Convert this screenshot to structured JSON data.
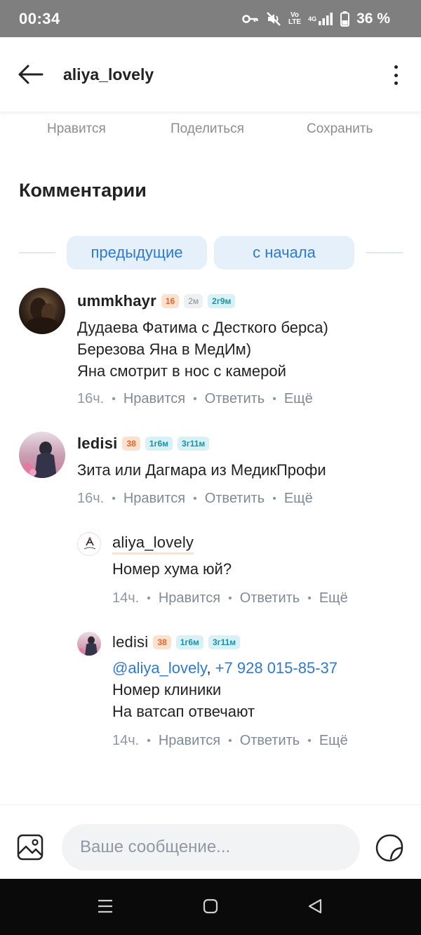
{
  "status_bar": {
    "time": "00:34",
    "battery": "36 %",
    "network_top": "Vo",
    "network_bottom": "LTE",
    "signal_type": "4G",
    "icons": [
      "key-icon",
      "mute-icon",
      "volte-icon",
      "signal-icon",
      "battery-icon"
    ]
  },
  "header": {
    "title": "aliya_lovely",
    "back_icon": "arrow-left-icon",
    "more_icon": "more-vertical-icon"
  },
  "actions": {
    "like": "Нравится",
    "share": "Поделиться",
    "save": "Сохранить"
  },
  "comments_section": {
    "title": "Комментарии",
    "load_previous": "предыдущие",
    "load_from_start": "с начала"
  },
  "comments": [
    {
      "author": "ummkhayr",
      "badges": [
        "16",
        "2м",
        "2г9м"
      ],
      "lines": [
        "Дудаева Фатима с Десткого берса)",
        "Березова Яна в МедИм)",
        "Яна смотрит в нос с камерой"
      ],
      "time": "16ч.",
      "like": "Нравится",
      "reply": "Ответить",
      "more": "Ещё"
    },
    {
      "author": "ledisi",
      "badges": [
        "38",
        "1г6м",
        "3г11м"
      ],
      "lines": [
        "Зита или Дагмара из МедикПрофи"
      ],
      "time": "16ч.",
      "like": "Нравится",
      "reply": "Ответить",
      "more": "Ещё"
    }
  ],
  "replies": [
    {
      "author": "aliya_lovely",
      "lines": [
        "Номер хума юй?"
      ],
      "time": "14ч.",
      "like": "Нравится",
      "reply": "Ответить",
      "more": "Ещё"
    },
    {
      "author": "ledisi",
      "badges": [
        "38",
        "1г6м",
        "3г11м"
      ],
      "mention": "@aliya_lovely",
      "separator": ",",
      "phone": "+7 928 015-85-37",
      "lines": [
        "Номер клиники",
        "На ватсап отвечают"
      ],
      "time": "14ч.",
      "like": "Нравится",
      "reply": "Ответить",
      "more": "Ещё"
    }
  ],
  "composer": {
    "placeholder": "Ваше сообщение...",
    "value": "",
    "image_icon": "image-icon",
    "sticker_icon": "sticker-icon"
  },
  "navbar": {
    "icons": [
      "menu-icon",
      "home-icon",
      "back-triangle-icon"
    ]
  },
  "colors": {
    "accent": "#2e7ad1",
    "badge_orange": "#e5652b",
    "badge_blue": "#1e8fa8",
    "status_bar": "#7f7f7f"
  }
}
